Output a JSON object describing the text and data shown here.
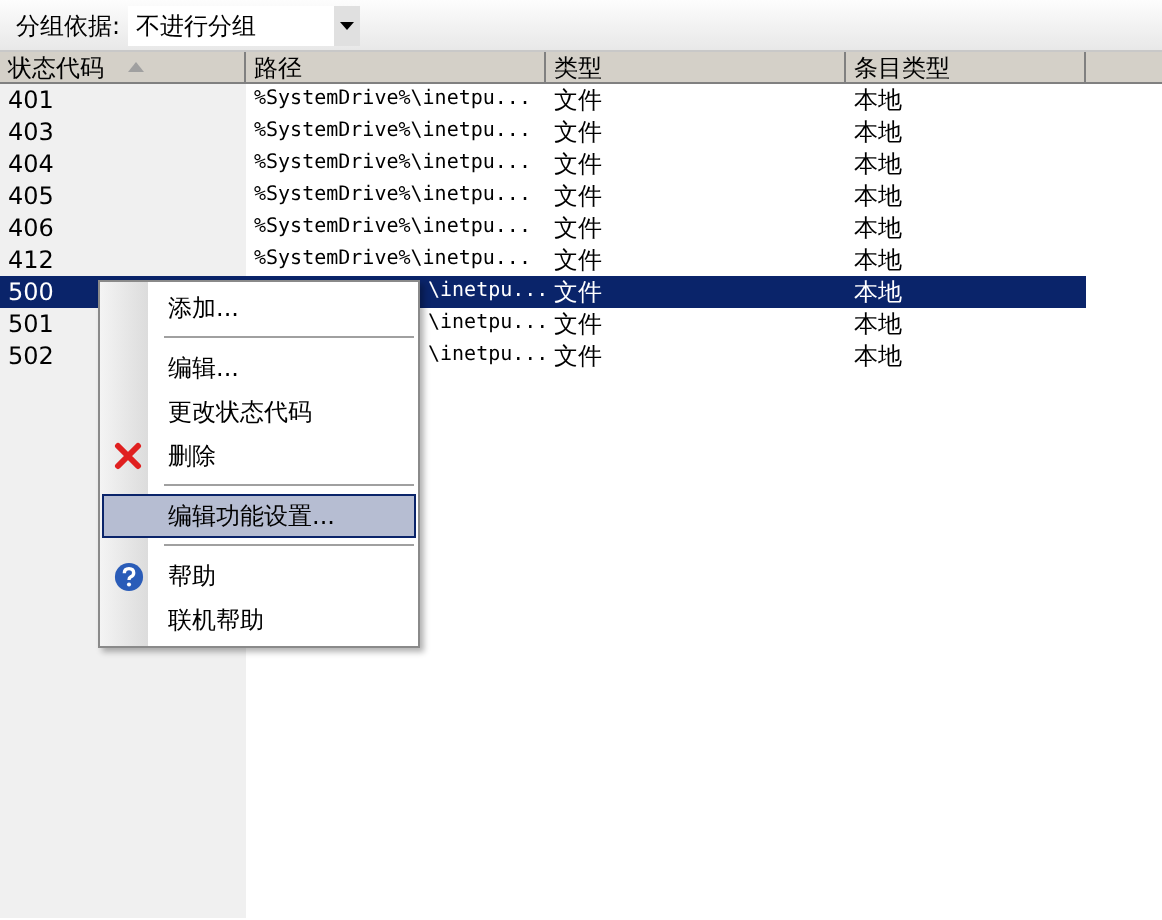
{
  "toolbar": {
    "label": "分组依据:",
    "group_by": {
      "value": "不进行分组"
    }
  },
  "table": {
    "columns": [
      {
        "label": "状态代码",
        "sorted": true
      },
      {
        "label": "路径",
        "sorted": false
      },
      {
        "label": "类型",
        "sorted": false
      },
      {
        "label": "条目类型",
        "sorted": false
      }
    ],
    "rows": [
      {
        "cells": [
          "401",
          "%SystemDrive%\\inetpu...",
          "文件",
          "本地"
        ],
        "selected": false
      },
      {
        "cells": [
          "403",
          "%SystemDrive%\\inetpu...",
          "文件",
          "本地"
        ],
        "selected": false
      },
      {
        "cells": [
          "404",
          "%SystemDrive%\\inetpu...",
          "文件",
          "本地"
        ],
        "selected": false
      },
      {
        "cells": [
          "405",
          "%SystemDrive%\\inetpu...",
          "文件",
          "本地"
        ],
        "selected": false
      },
      {
        "cells": [
          "406",
          "%SystemDrive%\\inetpu...",
          "文件",
          "本地"
        ],
        "selected": false
      },
      {
        "cells": [
          "412",
          "%SystemDrive%\\inetpu...",
          "文件",
          "本地"
        ],
        "selected": false
      },
      {
        "cells": [
          "500",
          "\\inetpu...",
          "文件",
          "本地"
        ],
        "selected": true
      },
      {
        "cells": [
          "501",
          "\\inetpu...",
          "文件",
          "本地"
        ],
        "selected": false
      },
      {
        "cells": [
          "502",
          "\\inetpu...",
          "文件",
          "本地"
        ],
        "selected": false
      }
    ]
  },
  "context_menu": {
    "items": [
      {
        "kind": "item",
        "label": "添加...",
        "selected": false
      },
      {
        "kind": "separator"
      },
      {
        "kind": "item",
        "label": "编辑...",
        "selected": false
      },
      {
        "kind": "item",
        "label": "更改状态代码",
        "selected": false
      },
      {
        "kind": "delete",
        "label": "删除",
        "selected": false
      },
      {
        "kind": "separator"
      },
      {
        "kind": "item",
        "label": "编辑功能设置...",
        "selected": true
      },
      {
        "kind": "separator"
      },
      {
        "kind": "help",
        "label": "帮助",
        "selected": false
      },
      {
        "kind": "item",
        "label": "联机帮助",
        "selected": false
      }
    ]
  }
}
